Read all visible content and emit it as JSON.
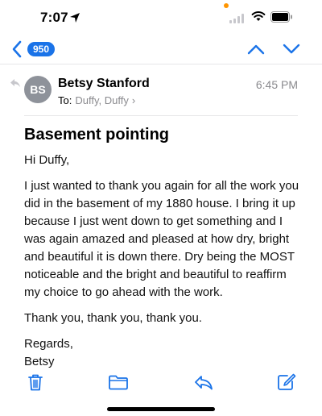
{
  "status_bar": {
    "time": "7:07"
  },
  "nav": {
    "unread_count": "950"
  },
  "message": {
    "sender_name": "Betsy Stanford",
    "sender_initials": "BS",
    "to_label": "To:",
    "to_names": "Duffy, Duffy",
    "to_chevron": "›",
    "time": "6:45 PM",
    "subject": "Basement pointing",
    "body": {
      "greeting": "Hi Duffy,",
      "paragraph": "I just wanted to thank you again for all the work you did in the basement of my 1880 house. I bring it up because I just went down to get something and I was again amazed and pleased at how dry, bright and beautiful it is down there. Dry being the MOST noticeable and the bright and beautiful to reaffirm my choice to go ahead with the work.",
      "thanks": "Thank you, thank you, thank you.",
      "closing": "Regards,",
      "signature": "Betsy"
    }
  },
  "toolbar": {
    "icons": [
      "trash-icon",
      "folder-icon",
      "reply-icon",
      "compose-icon"
    ]
  },
  "colors": {
    "accent": "#1a73e8",
    "avatar": "#8e929a",
    "trash": "#1a73e8",
    "privacy_dot": "#ff9500",
    "secondary_text": "#8a8a8e"
  }
}
